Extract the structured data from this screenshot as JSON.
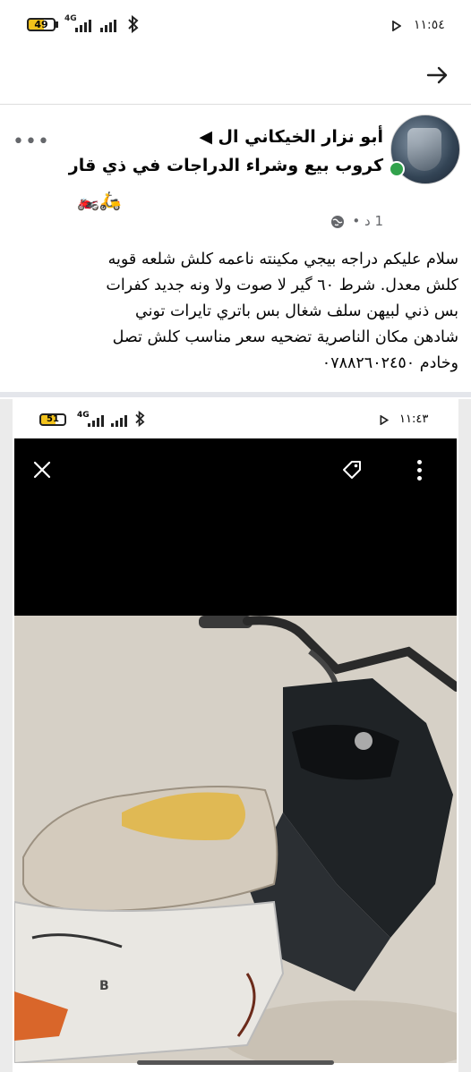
{
  "status_bar": {
    "battery": "49",
    "network": "4G",
    "time": "١١:٥٤"
  },
  "post": {
    "author": "أبو نزار الخيكاني ال",
    "group": "كروب بيع وشراء الدراجات في ذي قار",
    "emojis": "🏍️🛵",
    "time_meta": "1 د •",
    "text_lines": [
      "سلام عليكم دراجه بيجي مكينته ناعمه كلش شلعه قويه",
      "كلش معدل.  شرط ٦٠ گير لا صوت ولا ونه جديد    كفرات",
      "بس ذني لبيهن سلف شغال بس باتري     تايرات توني",
      "شادهن مكان الناصرية تضحيه سعر  مناسب كلش تصل",
      "وخادم ٠٧٨٨٢٦٠٢٤٥٠"
    ]
  },
  "embedded_screenshot": {
    "battery": "51",
    "network": "4G",
    "time": "١١:٤٣"
  },
  "colors": {
    "online": "#31a24c",
    "divider": "#e4e6eb",
    "secondary_text": "#65676b"
  }
}
